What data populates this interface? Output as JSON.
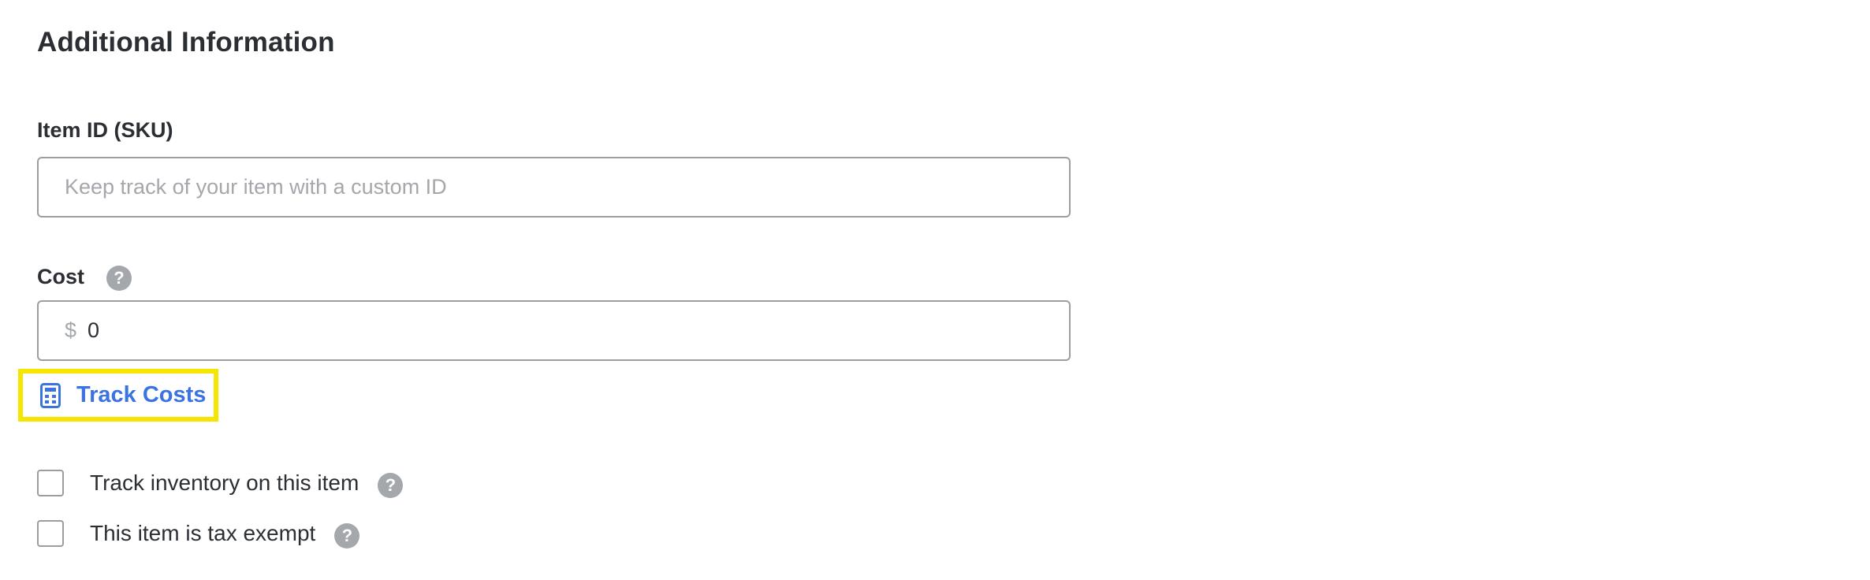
{
  "section": {
    "title": "Additional Information"
  },
  "sku": {
    "label": "Item ID (SKU)",
    "value": "",
    "placeholder": "Keep track of your item with a custom ID"
  },
  "cost": {
    "label": "Cost",
    "help_icon": "question-circle-icon",
    "currency_symbol": "$",
    "value": "0"
  },
  "track_costs": {
    "label": "Track Costs",
    "icon": "calculator-icon",
    "highlight_color": "#f4e600",
    "link_color": "#3b73e0"
  },
  "options": {
    "track_inventory": {
      "label": "Track inventory on this item",
      "checked": false,
      "help_icon": "question-circle-icon"
    },
    "tax_exempt": {
      "label": "This item is tax exempt",
      "checked": false,
      "help_icon": "question-circle-icon"
    }
  },
  "help_glyph": "?"
}
